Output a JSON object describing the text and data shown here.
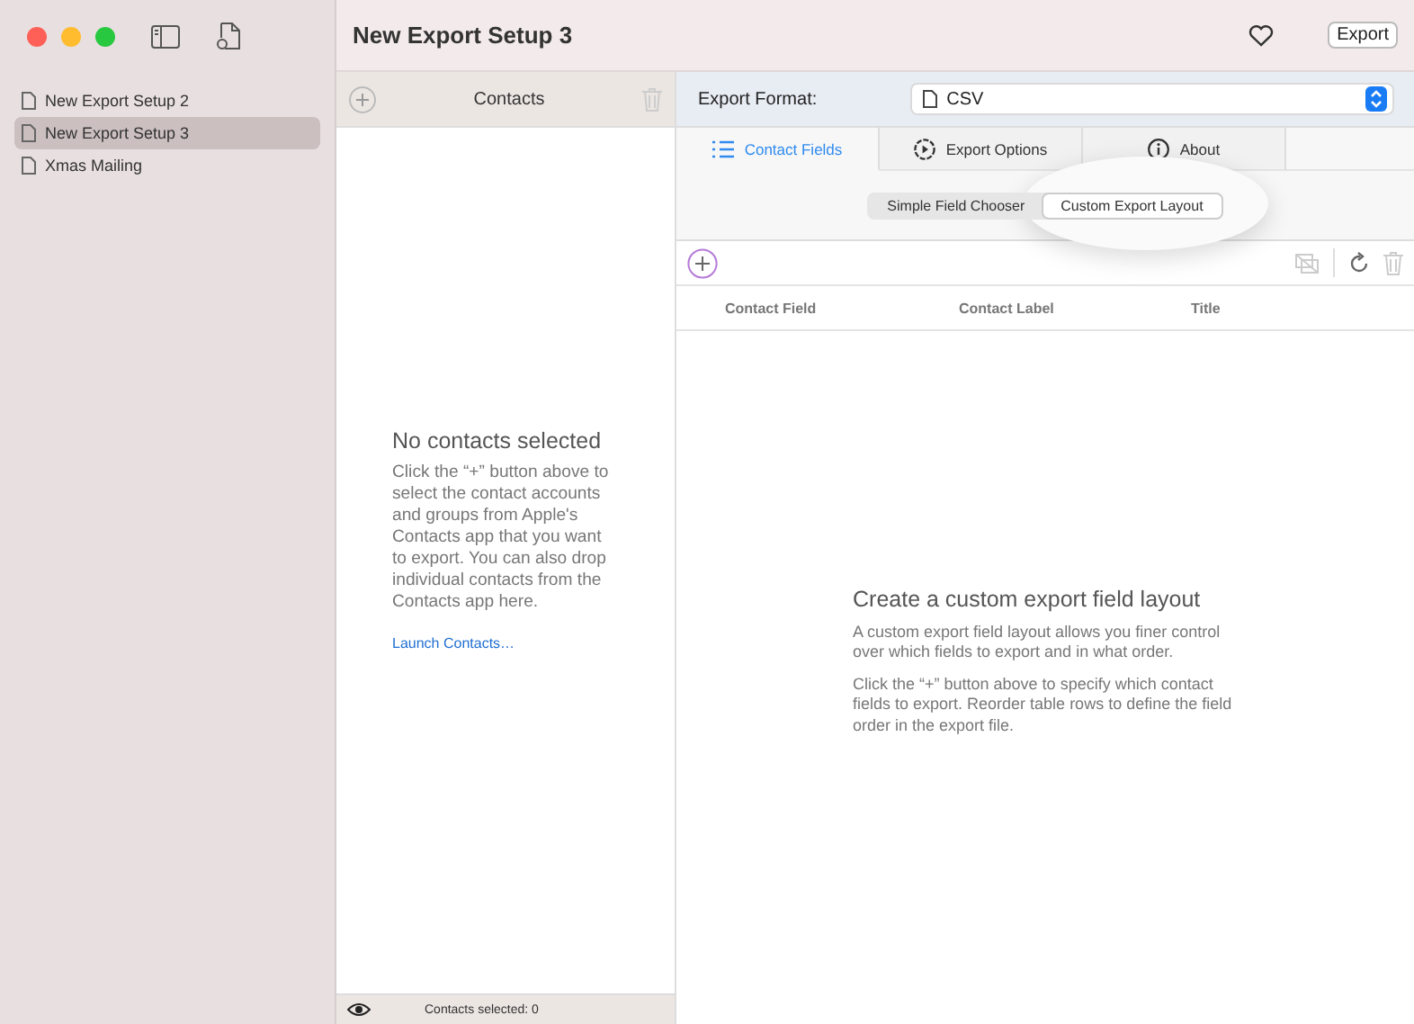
{
  "window": {
    "title": "New Export Setup 3",
    "export_button": "Export"
  },
  "sidebar": {
    "items": [
      {
        "label": "New Export Setup 2",
        "selected": false
      },
      {
        "label": "New Export Setup 3",
        "selected": true
      },
      {
        "label": "Xmas Mailing",
        "selected": false
      }
    ]
  },
  "contacts_panel": {
    "title": "Contacts",
    "empty_title": "No contacts selected",
    "empty_text": "Click the “+” button above to select the contact accounts and groups from Apple's Contacts app that you want to export. You can also drop individual contacts from the Contacts app here.",
    "link": "Launch Contacts…",
    "status": "Contacts selected: 0"
  },
  "export_format": {
    "label": "Export Format:",
    "value": "CSV"
  },
  "tabs": [
    {
      "label": "Contact Fields",
      "kind": "list",
      "selected": true
    },
    {
      "label": "Export Options",
      "kind": "play",
      "selected": false
    },
    {
      "label": "About",
      "kind": "info",
      "selected": false
    }
  ],
  "segments": [
    {
      "label": "Simple Field Chooser",
      "selected": false
    },
    {
      "label": "Custom Export Layout",
      "selected": true
    }
  ],
  "table": {
    "columns": [
      "Contact Field",
      "Contact Label",
      "Title"
    ]
  },
  "empty_state": {
    "title": "Create a custom export field layout",
    "paragraphs": [
      "A custom export field layout allows you finer control over which fields to export and in what order.",
      "Click the “+” button above to specify which contact fields to export. Reorder table rows to define the field order in the export file."
    ]
  }
}
